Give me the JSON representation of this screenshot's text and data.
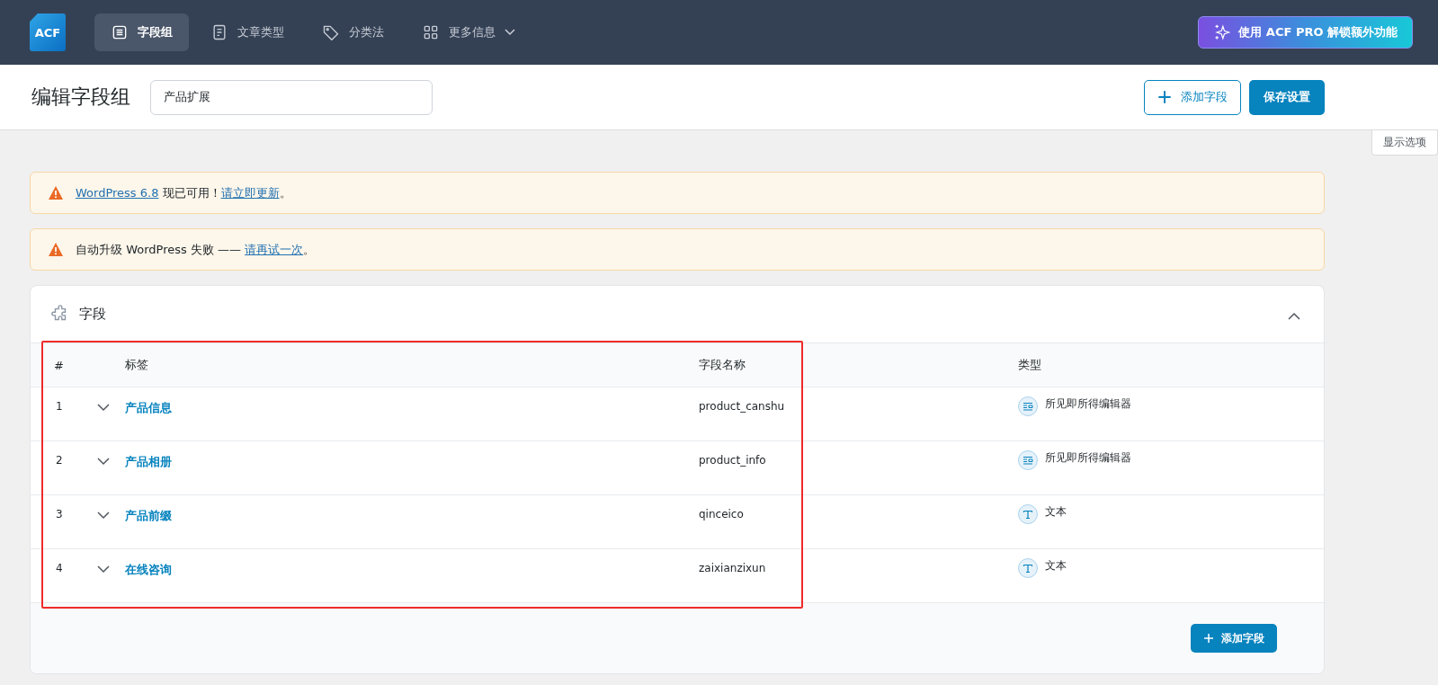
{
  "topbar": {
    "logo": "ACF",
    "tabs": [
      {
        "label": "字段组",
        "selected": true
      },
      {
        "label": "文章类型",
        "selected": false
      },
      {
        "label": "分类法",
        "selected": false
      },
      {
        "label": "更多信息",
        "selected": false,
        "dropdown": true
      }
    ],
    "upgrade_button": "使用 ACF PRO 解锁额外功能"
  },
  "header": {
    "title": "编辑字段组",
    "group_name": "产品扩展",
    "add_button": "添加字段",
    "save_button": "保存设置"
  },
  "screen_options": "显示选项",
  "notices": [
    {
      "parts": [
        {
          "text": "WordPress 6.8",
          "kind": "link"
        },
        {
          "text": " 现已可用！",
          "kind": "text"
        },
        {
          "text": "请立即更新",
          "kind": "link"
        },
        {
          "text": "。",
          "kind": "text"
        }
      ]
    },
    {
      "parts": [
        {
          "text": "自动升级 WordPress 失败 —— ",
          "kind": "text"
        },
        {
          "text": "请再试一次",
          "kind": "link"
        },
        {
          "text": "。",
          "kind": "text"
        }
      ]
    }
  ],
  "fields_panel": {
    "title": "字段",
    "expanded": true,
    "highlighted": true,
    "columns": [
      "#",
      "标签",
      "字段名称",
      "类型"
    ],
    "rows": [
      {
        "number": "1",
        "label": "产品信息",
        "name": "product_canshu",
        "type": "所见即所得编辑器",
        "kind": "wysiwyg"
      },
      {
        "number": "2",
        "label": "产品相册",
        "name": "product_info",
        "type": "所见即所得编辑器",
        "kind": "wysiwyg"
      },
      {
        "number": "3",
        "label": "产品前缀",
        "name": "qinceico",
        "type": "文本",
        "kind": "text"
      },
      {
        "number": "4",
        "label": "在线咨询",
        "name": "zaixianzixun",
        "type": "文本",
        "kind": "text"
      }
    ],
    "add_button": "添加字段"
  }
}
